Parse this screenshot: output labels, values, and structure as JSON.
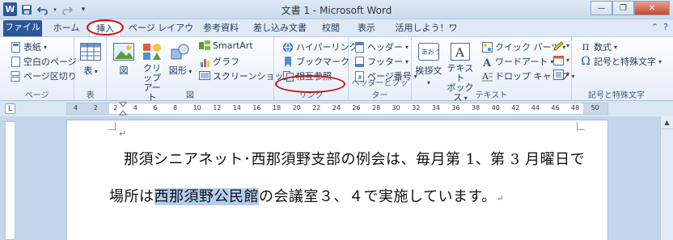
{
  "window": {
    "title": "文書 1 - Microsoft Word"
  },
  "qat": {
    "logo": "W",
    "save_icon": "save-icon",
    "undo_icon": "undo-icon",
    "redo_icon": "redo-icon",
    "customize_icon": "customize-icon"
  },
  "tabs": [
    {
      "label": "ファイル"
    },
    {
      "label": "ホーム"
    },
    {
      "label": "挿入"
    },
    {
      "label": "ページ レイアウト"
    },
    {
      "label": "参考資料"
    },
    {
      "label": "差し込み文書"
    },
    {
      "label": "校閲"
    },
    {
      "label": "表示"
    },
    {
      "label": "活用しよう！ワード"
    }
  ],
  "ribbon": {
    "pages": {
      "label": "ページ",
      "cover": "表紙",
      "blank": "空白のページ",
      "break": "ページ区切り"
    },
    "tables": {
      "label": "表",
      "table": "表"
    },
    "illustrations": {
      "label": "図",
      "picture": "図",
      "clipart1": "クリップ",
      "clipart2": "アート",
      "shapes": "図形",
      "smartart": "SmartArt",
      "chart": "グラフ",
      "screenshot": "スクリーンショット"
    },
    "links": {
      "label": "リンク",
      "hyperlink": "ハイパーリンク",
      "bookmark": "ブックマーク",
      "crossref": "相互参照"
    },
    "headerfooter": {
      "label": "ヘッダーとフッター",
      "header": "ヘッダー",
      "footer": "フッター",
      "pagenum": "ページ番号"
    },
    "text": {
      "label": "テキスト",
      "greeting": "挨拶文",
      "textbox1": "テキスト",
      "textbox2": "ボックス",
      "quickparts": "クイック パーツ",
      "wordart": "ワードアート",
      "dropcap": "ドロップ キャップ"
    },
    "symbols": {
      "label": "記号と特殊文字",
      "equation": "数式",
      "symbol": "記号と特殊文字"
    }
  },
  "ruler": {
    "ticks": [
      "4",
      "2",
      "2",
      "4",
      "6",
      "8",
      "10",
      "12",
      "14",
      "16",
      "18",
      "20",
      "22",
      "24",
      "26",
      "28",
      "30",
      "32",
      "34",
      "36",
      "38",
      "40",
      "42",
      "44",
      "46",
      "48",
      "50"
    ]
  },
  "document": {
    "line1": "那須シニアネット･西那須野支部の例会は、毎月第 1、第 3 月曜日で",
    "line2_pre": "場所は",
    "line2_sel": "西那須野公民館",
    "line2_post": "の会議室３、４で実施しています。",
    "mark": "↵",
    "empty_mark": "↵"
  },
  "colors": {
    "file_tab": "#2b579a",
    "annotation": "#cc1111",
    "selection": "#b3cdf0"
  }
}
